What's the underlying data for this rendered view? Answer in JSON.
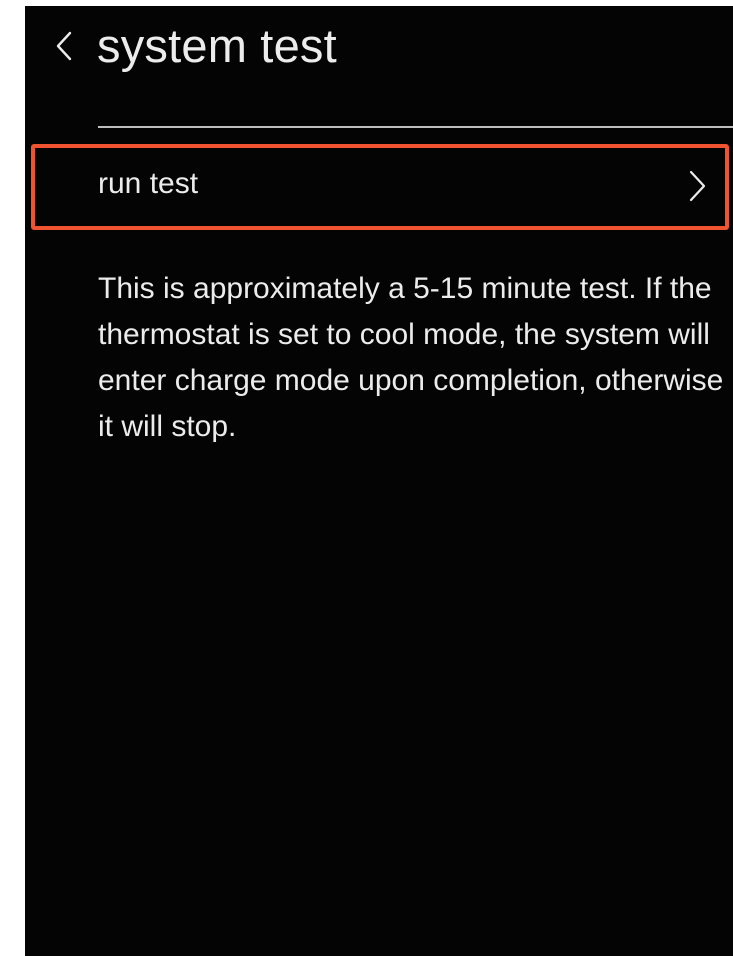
{
  "header": {
    "back_icon": "chevron-left-icon",
    "title": "system test"
  },
  "menu": {
    "items": [
      {
        "label": "run test",
        "icon": "chevron-right-icon",
        "highlighted": true
      }
    ]
  },
  "description": "This is approximately a 5-15 minute test. If the thermostat is set to cool mode, the system will enter charge mode upon completion, otherwise it will stop.",
  "colors": {
    "background": "#040404",
    "text": "#ececec",
    "highlight_border": "#ef532f",
    "divider": "#bdbdbd"
  }
}
